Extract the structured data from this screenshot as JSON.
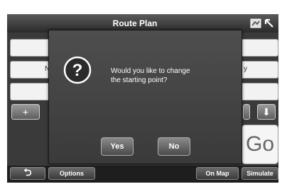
{
  "header": {
    "title": "Route Plan",
    "icons": [
      "map-icon",
      "cursor-arrow-icon"
    ]
  },
  "fields": {
    "row2_left_partial": "N",
    "row2_right_partial": "y"
  },
  "controls": {
    "add_label": "+",
    "down_label": "⬇",
    "go_label": "Go"
  },
  "dialog": {
    "icon": "question-icon",
    "message_line1": "Would you like to change",
    "message_line2": "the starting point?",
    "yes_label": "Yes",
    "no_label": "No"
  },
  "bottom": {
    "back_label": "⮌",
    "options_label": "Options",
    "onmap_label": "On Map",
    "simulate_label": "Simulate"
  }
}
